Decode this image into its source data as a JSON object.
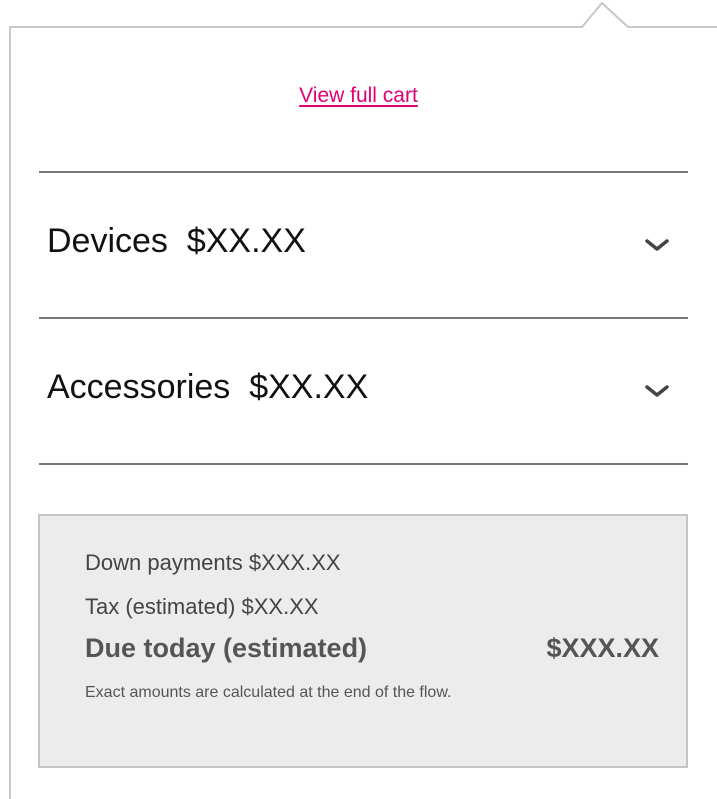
{
  "cart_popover": {
    "view_full_cart_link": "View full cart",
    "sections": [
      {
        "title": "Devices",
        "amount": "$XX.XX",
        "expand_icon": "chevron-down-icon"
      },
      {
        "title": "Accessories",
        "amount": "$XX.XX",
        "expand_icon": "chevron-down-icon"
      }
    ],
    "summary": {
      "down_payments": "Down payments $XXX.XX",
      "tax": "Tax (estimated) $XX.XX",
      "due_today_label": "Due today (estimated)",
      "due_today_amount": "$XXX.XX",
      "note": "Exact amounts are calculated at the end of the flow."
    }
  },
  "colors": {
    "link": "#e20074",
    "divider": "#777777",
    "summary_background": "#ececec",
    "summary_border": "#c4c4c4",
    "popover_border": "#c8c8c8"
  }
}
